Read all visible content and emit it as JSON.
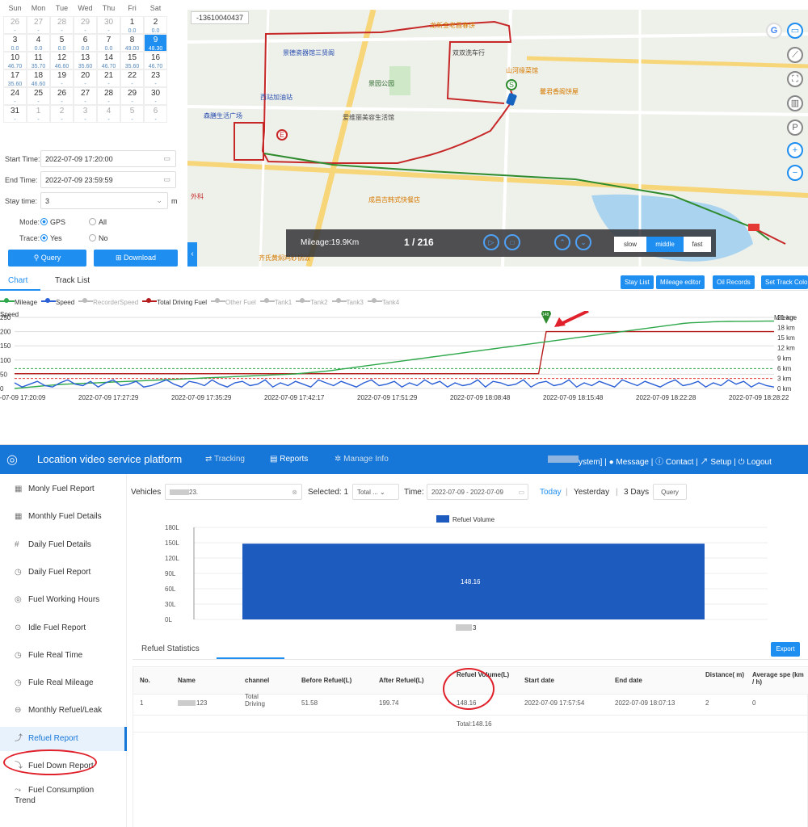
{
  "calendar": {
    "weekdays": [
      "Sun",
      "Mon",
      "Tue",
      "Wed",
      "Thu",
      "Fri",
      "Sat"
    ],
    "cells": [
      {
        "d": "26",
        "v": "-",
        "o": 1
      },
      {
        "d": "27",
        "v": "-",
        "o": 1
      },
      {
        "d": "28",
        "v": "-",
        "o": 1
      },
      {
        "d": "29",
        "v": "-",
        "o": 1
      },
      {
        "d": "30",
        "v": "-",
        "o": 1
      },
      {
        "d": "1",
        "v": "0.0"
      },
      {
        "d": "2",
        "v": "0.0"
      },
      {
        "d": "3",
        "v": "0.0"
      },
      {
        "d": "4",
        "v": "0.0"
      },
      {
        "d": "5",
        "v": "0.0"
      },
      {
        "d": "6",
        "v": "0.0"
      },
      {
        "d": "7",
        "v": "0.0"
      },
      {
        "d": "8",
        "v": "49.00"
      },
      {
        "d": "9",
        "v": "48.30",
        "s": 1
      },
      {
        "d": "10",
        "v": "46.70"
      },
      {
        "d": "11",
        "v": "35.70"
      },
      {
        "d": "12",
        "v": "46.60"
      },
      {
        "d": "13",
        "v": "35.60"
      },
      {
        "d": "14",
        "v": "46.70"
      },
      {
        "d": "15",
        "v": "35.60"
      },
      {
        "d": "16",
        "v": "46.70"
      },
      {
        "d": "17",
        "v": "35.60"
      },
      {
        "d": "18",
        "v": "46.60"
      },
      {
        "d": "19",
        "v": "-"
      },
      {
        "d": "20",
        "v": "-"
      },
      {
        "d": "21",
        "v": "-"
      },
      {
        "d": "22",
        "v": "-"
      },
      {
        "d": "23",
        "v": "-"
      },
      {
        "d": "24",
        "v": "-"
      },
      {
        "d": "25",
        "v": "-"
      },
      {
        "d": "26",
        "v": "-"
      },
      {
        "d": "27",
        "v": "-"
      },
      {
        "d": "28",
        "v": "-"
      },
      {
        "d": "29",
        "v": "-"
      },
      {
        "d": "30",
        "v": "-"
      },
      {
        "d": "31",
        "v": "-"
      },
      {
        "d": "1",
        "v": "-",
        "o": 1
      },
      {
        "d": "2",
        "v": "-",
        "o": 1
      },
      {
        "d": "3",
        "v": "-",
        "o": 1
      },
      {
        "d": "4",
        "v": "-",
        "o": 1
      },
      {
        "d": "5",
        "v": "-",
        "o": 1
      },
      {
        "d": "6",
        "v": "-",
        "o": 1
      }
    ]
  },
  "form": {
    "start_label": "Start Time:",
    "start_value": "2022-07-09 17:20:00",
    "end_label": "End Time:",
    "end_value": "2022-07-09 23:59:59",
    "stay_label": "Stay time:",
    "stay_value": "3",
    "stay_unit": "m",
    "mode_label": "Mode:",
    "mode_gps": "GPS",
    "mode_all": "All",
    "trace_label": "Trace:",
    "trace_yes": "Yes",
    "trace_no": "No",
    "query_btn": "Query",
    "download_btn": "Download"
  },
  "map": {
    "vehicle_label": "-13610040437",
    "places": [
      "龙新金老昌春饼",
      "景德瓷器馆三贤阁",
      "双双洗车行",
      "景园公园",
      "山河缘菜馆",
      "馨君香阁饼屋",
      "西站加油站",
      "森膳生活广场",
      "爱维丽美容生活馆",
      "成昌吉韩式快餐店",
      "齐氏黄焖鸡砂锅饭",
      "外科"
    ],
    "mileage": "Mileage:19.9Km",
    "progress": "1 / 216",
    "speed_slow": "slow",
    "speed_middle": "middle",
    "speed_fast": "fast"
  },
  "tabs": {
    "chart": "Chart",
    "track_list": "Track List"
  },
  "actions": [
    "Stay List",
    "Mileage editor",
    "Oil Records",
    "Set Track Colo"
  ],
  "legend": [
    {
      "name": "Mileage",
      "color": "#2ea84a",
      "on": 1
    },
    {
      "name": "Speed",
      "color": "#2a5fd6",
      "on": 1
    },
    {
      "name": "RecorderSpeed",
      "color": "#bbbbbb",
      "on": 0
    },
    {
      "name": "Total Driving Fuel",
      "color": "#b71c1c",
      "on": 1
    },
    {
      "name": "Other Fuel",
      "color": "#bbbbbb",
      "on": 0
    },
    {
      "name": "Tank1",
      "color": "#bbbbbb",
      "on": 0
    },
    {
      "name": "Tank2",
      "color": "#bbbbbb",
      "on": 0
    },
    {
      "name": "Tank3",
      "color": "#bbbbbb",
      "on": 0
    },
    {
      "name": "Tank4",
      "color": "#bbbbbb",
      "on": 0
    }
  ],
  "chart_data": [
    {
      "type": "line",
      "ylabel": "Speed",
      "y2label": "Mileage",
      "ylim": [
        0,
        250
      ],
      "y2lim": [
        0,
        21
      ],
      "yticks": [
        "250",
        "200",
        "150",
        "100",
        "50",
        "0"
      ],
      "y2ticks": [
        "21 km",
        "18 km",
        "15 km",
        "12 km",
        "9 km",
        "6 km",
        "3 km",
        "0 km"
      ],
      "xticks": [
        "2022-07-09 17:20:09",
        "2022-07-09 17:27:29",
        "2022-07-09 17:35:29",
        "2022-07-09 17:42:17",
        "2022-07-09 17:51:29",
        "2022-07-09 18:08:48",
        "2022-07-09 18:15:48",
        "2022-07-09 18:22:28",
        "2022-07-09 18:28:22"
      ],
      "marker": "148",
      "series": [
        {
          "name": "Total Driving Fuel",
          "values": [
            52,
            52,
            52,
            52,
            52,
            52,
            52,
            52,
            52,
            52,
            52,
            52,
            52,
            52,
            52,
            52,
            52,
            52,
            52,
            52,
            52,
            52,
            52,
            52,
            52,
            52,
            52,
            52,
            52,
            52,
            52,
            52,
            52,
            52,
            52,
            52,
            52,
            52,
            52,
            52,
            52,
            52,
            52,
            52,
            52,
            52,
            52,
            52,
            52,
            52,
            52,
            52,
            52,
            52,
            52,
            52,
            52,
            52,
            52,
            52,
            52,
            52,
            52,
            52,
            52,
            52,
            52,
            52,
            52,
            52,
            200,
            200,
            200,
            200,
            200,
            200,
            200,
            200,
            200,
            200,
            200,
            200,
            200,
            200,
            200,
            200,
            200,
            200,
            200,
            200,
            200,
            200,
            200,
            200,
            200,
            200,
            200,
            200,
            200,
            200,
            200
          ]
        },
        {
          "name": "Mileage",
          "values": [
            0,
            0.2,
            0.4,
            0.6,
            0.8,
            1,
            1.2,
            1.3,
            1.4,
            1.5,
            1.6,
            1.7,
            1.8,
            1.9,
            2,
            2.1,
            2.2,
            2.3,
            2.4,
            2.5,
            2.6,
            2.7,
            2.8,
            2.9,
            3,
            3.1,
            3.2,
            3.3,
            3.4,
            3.5,
            3.6,
            3.7,
            3.8,
            3.9,
            4,
            4.1,
            4.2,
            4.3,
            4.5,
            4.7,
            4.9,
            5.1,
            5.4,
            5.7,
            6,
            6.3,
            6.6,
            6.9,
            7.2,
            7.5,
            7.8,
            8.1,
            8.4,
            8.7,
            9,
            9.3,
            9.6,
            9.9,
            10.2,
            10.5,
            10.8,
            11.1,
            11.4,
            11.7,
            12,
            12.3,
            12.6,
            12.9,
            13.2,
            13.5,
            13.8,
            14.1,
            14.4,
            14.7,
            15,
            15.3,
            15.6,
            15.9,
            16.2,
            16.5,
            16.8,
            17.1,
            17.4,
            17.7,
            18,
            18.3,
            18.6,
            18.9,
            19.2,
            19.4,
            19.5,
            19.6,
            19.7,
            19.75,
            19.8,
            19.82,
            19.84,
            19.86,
            19.88,
            19.9,
            19.9
          ]
        },
        {
          "name": "Speed",
          "values": [
            20,
            5,
            15,
            25,
            10,
            5,
            20,
            30,
            15,
            10,
            25,
            5,
            20,
            30,
            10,
            15,
            25,
            5,
            10,
            20,
            30,
            15,
            5,
            25,
            20,
            10,
            30,
            15,
            5,
            20,
            25,
            10,
            15,
            30,
            5,
            20,
            10,
            25,
            15,
            5,
            30,
            20,
            10,
            25,
            15,
            5,
            20,
            30,
            10,
            15,
            25,
            5,
            20,
            10,
            30,
            15,
            25,
            5,
            20,
            10,
            15,
            30,
            5,
            25,
            20,
            10,
            15,
            30,
            5,
            20,
            25,
            10,
            15,
            30,
            5,
            20,
            10,
            25,
            15,
            5,
            30,
            20,
            10,
            25,
            15,
            5,
            20,
            30,
            10,
            15,
            25,
            5,
            20,
            10,
            30,
            15,
            25,
            5,
            20,
            10,
            5
          ]
        }
      ]
    },
    {
      "type": "bar",
      "legend": "Refuel Volume",
      "categories": [
        "3"
      ],
      "values": [
        148.16
      ],
      "data_label": "148.16",
      "ylim": [
        0,
        180
      ],
      "yticks": [
        "180L",
        "150L",
        "120L",
        "90L",
        "60L",
        "30L",
        "0L"
      ]
    }
  ],
  "app": {
    "title": "Location video service platform",
    "nav": [
      "Tracking",
      "Reports",
      "Manage Info"
    ],
    "user_right": "ystem] | ● Message | ⓘ Contact | ↗ Setup | ⏻ Logout"
  },
  "side": [
    {
      "label": "Monly Fuel Report",
      "ico": "▦"
    },
    {
      "label": "Monthly Fuel Details",
      "ico": "▦"
    },
    {
      "label": "Daily Fuel Details",
      "ico": "#"
    },
    {
      "label": "Daily Fuel Report",
      "ico": "◷"
    },
    {
      "label": "Fuel Working Hours",
      "ico": "◎"
    },
    {
      "label": "Idle Fuel Report",
      "ico": "⊙"
    },
    {
      "label": "Fule Real Time",
      "ico": "◷"
    },
    {
      "label": "Fule Real Mileage",
      "ico": "◷"
    },
    {
      "label": "Monthly Refuel/Leak",
      "ico": "⊖"
    },
    {
      "label": "Refuel Report",
      "ico": "⤴",
      "active": 1
    },
    {
      "label": "Fuel Down Report",
      "ico": "⤵"
    },
    {
      "label": "Fuel Consumption",
      "label2": "Trend",
      "ico": "⤳"
    }
  ],
  "filters": {
    "vehicles_label": "Vehicles",
    "vehicles_value": "23.",
    "selected": "Selected: 1",
    "total": "Total ...",
    "time_label": "Time:",
    "time_value": "2022-07-09 - 2022-07-09",
    "today": "Today",
    "yesterday": "Yesterday",
    "three_days": "3 Days",
    "query": "Query"
  },
  "stats": {
    "tab": "Refuel Statistics",
    "export": "Export",
    "headers": [
      "No.",
      "Name",
      "channel",
      "Before Refuel(L)",
      "After Refuel(L)",
      "Refuel Volume(L)",
      "Start date",
      "End date",
      "Distance( m)",
      "Average spe (km / h)"
    ],
    "row": [
      "1",
      "123",
      "Total Driving",
      "51.58",
      "199.74",
      "148.16",
      "2022-07-09 17:57:54",
      "2022-07-09 18:07:13",
      "2",
      "0"
    ],
    "total": "Total:148.16"
  },
  "colors": {
    "accent": "#1e8ef0",
    "header": "#1677d8",
    "highlight_circle": "#e0202a"
  }
}
